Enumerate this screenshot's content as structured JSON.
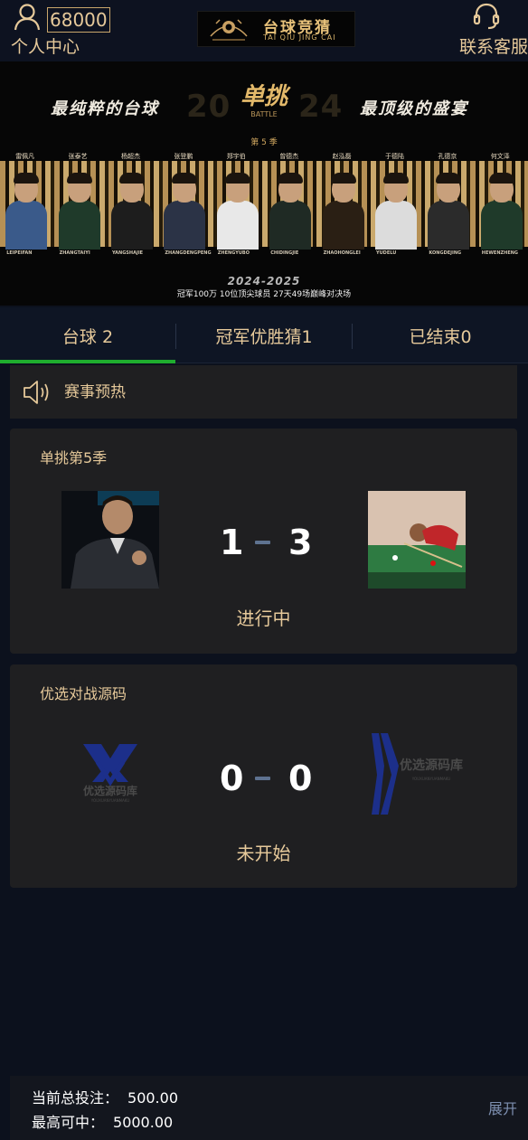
{
  "header": {
    "balance": "68000",
    "user_center_label": "个人中心",
    "logo": {
      "text_cn": "台球竞猜",
      "text_en": "TAI QIU JING CAI"
    },
    "service_label": "联系客服"
  },
  "banner": {
    "slogan_left": "最纯粹的台球",
    "slogan_right": "最顶级的盛宴",
    "year_left": "20",
    "year_right": "24",
    "title": "单挑",
    "title_sub": "BATTLE",
    "season": "第 5 季",
    "player_names": [
      "雷佩凡",
      "张泰艺",
      "杨超杰",
      "张登鹏",
      "郑宇伯",
      "曾德杰",
      "赵泓磊",
      "于德陆",
      "孔德京",
      "何文泽"
    ],
    "player_en": [
      "LEIPEIFAN",
      "ZHANGTAIYI",
      "YANGSHAJIE",
      "ZHANGDENGPENG",
      "ZHENGYUBO",
      "CHIDINGJIE",
      "ZHAOHONGLEI",
      "YUDELU",
      "KONGDEJING",
      "HEWENZHENG"
    ],
    "years": "2024-2025",
    "prize_text": "冠军100万   10位顶尖球员   27天49场巅峰对决场"
  },
  "tabs": [
    {
      "label": "台球 2",
      "active": true
    },
    {
      "label": "冠军优胜猜1",
      "active": false
    },
    {
      "label": "已结束0",
      "active": false
    }
  ],
  "notice": {
    "text": "赛事预热",
    "icon": "speaker-icon"
  },
  "matches": [
    {
      "title": "单挑第5季",
      "home_score": "1",
      "away_score": "3",
      "status": "进行中"
    },
    {
      "title": "优选对战源码",
      "home_score": "0",
      "away_score": "0",
      "status": "未开始",
      "home_logo_text": "优选源码库",
      "away_logo_text": "优选源码库"
    }
  ],
  "footer": {
    "total_bet_label": "当前总投注：",
    "total_bet_value": "500.00",
    "max_win_label": "最高可中：",
    "max_win_value": "5000.00",
    "expand_label": "展开"
  },
  "colors": {
    "accent": "#e6c99a",
    "tab_active_underline": "#1fad2e",
    "background": "#0c111d",
    "card": "#1f1f21"
  }
}
